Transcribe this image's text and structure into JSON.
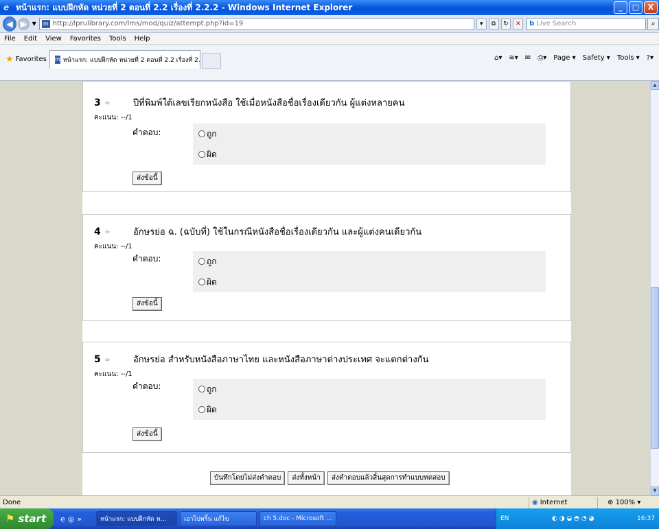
{
  "window": {
    "title": "หน้าแรก: แบบฝึกหัด หน่วยที่ 2 ตอนที่ 2.2 เรื่องที่ 2.2.2 - Windows Internet Explorer",
    "minimize": "_",
    "maximize": "□",
    "close": "X"
  },
  "address": {
    "url": "http://lprulibrary.com/lms/mod/quiz/attempt.php?id=19",
    "search_placeholder": "Live Search",
    "search_brand": "b"
  },
  "menu": [
    "File",
    "Edit",
    "View",
    "Favorites",
    "Tools",
    "Help"
  ],
  "favbar": {
    "favorites_label": "Favorites",
    "active_tab": "หน้าแรก: แบบฝึกหัด หน่วยที่ 2 ตอนที่ 2.2 เรื่องที่ 2.2.2",
    "commands": [
      "Page ▾",
      "Safety ▾",
      "Tools ▾"
    ]
  },
  "quiz": {
    "score_label": "คะแนน: --/1",
    "answer_label": "คำตอบ:",
    "submit_one": "ส่งข้อนี้",
    "questions": [
      {
        "number": "3",
        "text": "ปีที่พิมพ์ใต้เลขเรียกหนังสือ ใช้เมื่อหนังสือชื่อเรื่องเดียวกัน ผู้แต่งหลายคน",
        "options": [
          "ถูก",
          "ผิด"
        ]
      },
      {
        "number": "4",
        "text": "อักษรย่อ ฉ. (ฉบับที่) ใช้ในกรณีหนังสือชื่อเรื่องเดียวกัน และผู้แต่งคนเดียวกัน",
        "options": [
          "ถูก",
          "ผิด"
        ]
      },
      {
        "number": "5",
        "text": "อักษรย่อ สำหรับหนังสือภาษาไทย และหนังสือภาษาต่างประเทศ จะแตกต่างกัน",
        "options": [
          "ถูก",
          "ผิด"
        ]
      }
    ],
    "footer_buttons": [
      "บันทึกโดยไม่ส่งคำตอบ",
      "ส่งทั้งหน้า",
      "ส่งคำตอบแล้วสิ้นสุดการทำแบบทดสอบ"
    ]
  },
  "status": {
    "text": "Done",
    "zone": "Internet",
    "zoom": "100%"
  },
  "taskbar": {
    "start": "start",
    "items": [
      "หน้าแรก: แบบฝึกหัด ห...",
      "เอาไปพริ้น แก้ไข",
      "ch 5.doc - Microsoft ..."
    ],
    "lang": "EN",
    "clock": "16:37"
  }
}
